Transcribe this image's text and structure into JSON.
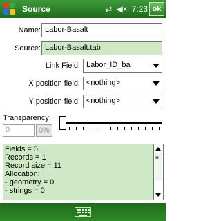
{
  "titlebar": {
    "title": "Source",
    "time": "7:23",
    "ok_label": "ok",
    "icons": [
      "windows-start-icon",
      "connectivity-icon",
      "volume-icon"
    ]
  },
  "form": {
    "name_label": "Name:",
    "name_value": "Labor-Basalt",
    "source_label": "Source:",
    "source_value": "Labor-Basalt.tab",
    "link_field_label": "Link Field:",
    "link_field_value": "Labor_ID_ba",
    "x_field_label": "X position field:",
    "x_field_value": "<nothing>",
    "y_field_label": "Y position field:",
    "y_field_value": "<nothing>",
    "transparency_label": "Transparency:",
    "transparency_value": "0",
    "percent_label": "0%",
    "transparency_slider_fraction": 0
  },
  "info": {
    "lines": [
      "Fields = 5",
      "Records = 1",
      "Record size = 11",
      "Allocation:",
      "- geometry = 0",
      "- strings = 0"
    ]
  },
  "colors": {
    "titlebar": "#2f7f2a",
    "field_green": "#cfe8c6"
  }
}
